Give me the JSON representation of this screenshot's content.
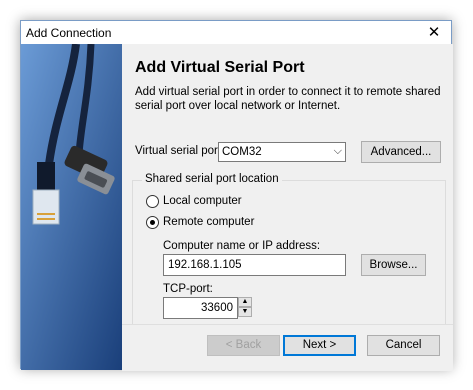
{
  "window": {
    "title": "Add Connection"
  },
  "page": {
    "heading": "Add Virtual Serial Port",
    "description": "Add virtual serial port in order to connect it to remote shared serial port over local network or Internet."
  },
  "port": {
    "label": "Virtual serial port:",
    "value": "COM32",
    "advanced_label": "Advanced..."
  },
  "location": {
    "group_title": "Shared serial port location",
    "local_label": "Local computer",
    "remote_label": "Remote computer",
    "selected": "remote"
  },
  "remote": {
    "host_label": "Computer name or IP address:",
    "host_value": "192.168.1.105",
    "browse_label": "Browse...",
    "port_label": "TCP-port:",
    "port_value": "33600"
  },
  "footer": {
    "back_label": "< Back",
    "next_label": "Next >",
    "cancel_label": "Cancel"
  },
  "icons": {
    "close": "close-icon",
    "dropdown": "chevron-down-icon",
    "banner": "serial-cable-image"
  }
}
